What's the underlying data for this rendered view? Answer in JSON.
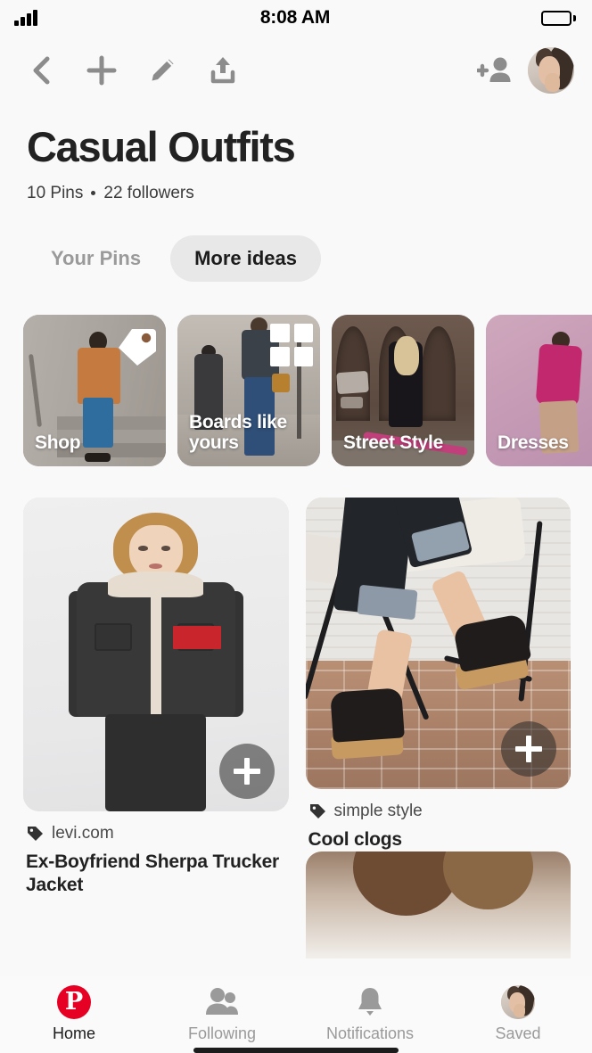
{
  "status_bar": {
    "time": "8:08 AM",
    "signal_icon": "signal-bars-icon",
    "battery_icon": "battery-full-icon"
  },
  "toolbar": {
    "back_icon": "chevron-left-icon",
    "add_icon": "plus-icon",
    "edit_icon": "pencil-icon",
    "share_icon": "share-upload-icon",
    "invite_icon": "add-person-icon",
    "avatar_icon": "user-avatar"
  },
  "board": {
    "title": "Casual Outfits",
    "pins_count": "10 Pins",
    "followers_count": "22 followers"
  },
  "tabs": [
    {
      "label": "Your Pins",
      "active": false
    },
    {
      "label": "More ideas",
      "active": true
    }
  ],
  "categories": [
    {
      "label": "Shop",
      "badge": "price-tag-icon"
    },
    {
      "label": "Boards like yours",
      "badge": "grid-icon"
    },
    {
      "label": "Street Style",
      "badge": ""
    },
    {
      "label": "Dresses",
      "badge": ""
    }
  ],
  "pins": [
    {
      "source": "levi.com",
      "source_icon": "tag-icon",
      "title": "Ex-Boyfriend Sherpa Trucker Jacket",
      "save_icon": "plus-icon"
    },
    {
      "source": "simple style",
      "source_icon": "tag-icon",
      "title": "Cool clogs",
      "save_icon": "plus-icon"
    }
  ],
  "bottom_nav": [
    {
      "label": "Home",
      "icon": "pinterest-logo-icon",
      "glyph": "P",
      "active": true
    },
    {
      "label": "Following",
      "icon": "people-icon",
      "active": false
    },
    {
      "label": "Notifications",
      "icon": "bell-icon",
      "active": false
    },
    {
      "label": "Saved",
      "icon": "user-avatar",
      "active": false
    }
  ],
  "colors": {
    "page_background": "#f9f9f9",
    "brand_red": "#e60023",
    "active_tab_background": "#e8e8e8",
    "muted_text": "#9a9a9a",
    "primary_text": "#222222"
  }
}
